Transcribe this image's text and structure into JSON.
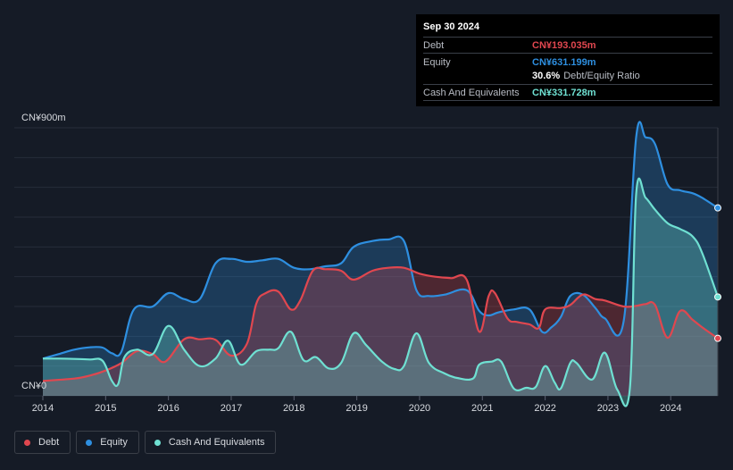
{
  "colors": {
    "debt": "#e0474f",
    "equity": "#2e8fe0",
    "cash": "#6fe0d2",
    "background": "#151b26"
  },
  "tooltip": {
    "date": "Sep 30 2024",
    "debt_label": "Debt",
    "debt_value": "CN¥193.035m",
    "equity_label": "Equity",
    "equity_value": "CN¥631.199m",
    "ratio_value": "30.6%",
    "ratio_label": "Debt/Equity Ratio",
    "cash_label": "Cash And Equivalents",
    "cash_value": "CN¥331.728m"
  },
  "legend": {
    "debt": "Debt",
    "equity": "Equity",
    "cash": "Cash And Equivalents"
  },
  "chart_data": {
    "type": "area",
    "title": "",
    "xlabel": "",
    "ylabel": "",
    "y_top_label": "CN¥900m",
    "y_bottom_label": "CN¥0",
    "ylim": [
      0,
      900
    ],
    "xlim": [
      2014,
      2024.75
    ],
    "x_ticks": [
      "2014",
      "2015",
      "2016",
      "2017",
      "2018",
      "2019",
      "2020",
      "2021",
      "2022",
      "2023",
      "2024"
    ],
    "grid": true,
    "legend_position": "bottom-left",
    "series": [
      {
        "name": "Debt",
        "color_key": "debt",
        "points": [
          [
            2014.0,
            50
          ],
          [
            2014.5,
            58
          ],
          [
            2014.75,
            68
          ],
          [
            2015.0,
            85
          ],
          [
            2015.25,
            110
          ],
          [
            2015.5,
            150
          ],
          [
            2015.75,
            140
          ],
          [
            2015.95,
            115
          ],
          [
            2016.25,
            190
          ],
          [
            2016.5,
            190
          ],
          [
            2016.75,
            188
          ],
          [
            2017.0,
            135
          ],
          [
            2017.25,
            175
          ],
          [
            2017.4,
            310
          ],
          [
            2017.55,
            345
          ],
          [
            2017.75,
            350
          ],
          [
            2017.95,
            290
          ],
          [
            2018.1,
            320
          ],
          [
            2018.3,
            420
          ],
          [
            2018.5,
            425
          ],
          [
            2018.75,
            420
          ],
          [
            2018.95,
            390
          ],
          [
            2019.25,
            420
          ],
          [
            2019.5,
            430
          ],
          [
            2019.75,
            430
          ],
          [
            2020.0,
            410
          ],
          [
            2020.25,
            400
          ],
          [
            2020.5,
            395
          ],
          [
            2020.75,
            390
          ],
          [
            2020.95,
            215
          ],
          [
            2021.1,
            335
          ],
          [
            2021.2,
            345
          ],
          [
            2021.4,
            260
          ],
          [
            2021.55,
            248
          ],
          [
            2021.75,
            240
          ],
          [
            2021.9,
            228
          ],
          [
            2022.0,
            290
          ],
          [
            2022.25,
            295
          ],
          [
            2022.4,
            305
          ],
          [
            2022.6,
            340
          ],
          [
            2022.8,
            325
          ],
          [
            2022.95,
            320
          ],
          [
            2023.25,
            300
          ],
          [
            2023.45,
            302
          ],
          [
            2023.6,
            308
          ],
          [
            2023.75,
            305
          ],
          [
            2023.95,
            195
          ],
          [
            2024.15,
            285
          ],
          [
            2024.35,
            255
          ],
          [
            2024.5,
            230
          ],
          [
            2024.75,
            193
          ]
        ]
      },
      {
        "name": "Equity",
        "color_key": "equity",
        "points": [
          [
            2014.0,
            125
          ],
          [
            2014.25,
            140
          ],
          [
            2014.5,
            155
          ],
          [
            2014.75,
            163
          ],
          [
            2014.95,
            162
          ],
          [
            2015.1,
            143
          ],
          [
            2015.25,
            148
          ],
          [
            2015.45,
            290
          ],
          [
            2015.75,
            300
          ],
          [
            2016.0,
            345
          ],
          [
            2016.25,
            325
          ],
          [
            2016.5,
            325
          ],
          [
            2016.75,
            445
          ],
          [
            2017.0,
            460
          ],
          [
            2017.25,
            450
          ],
          [
            2017.5,
            455
          ],
          [
            2017.75,
            460
          ],
          [
            2018.0,
            430
          ],
          [
            2018.25,
            425
          ],
          [
            2018.5,
            435
          ],
          [
            2018.75,
            445
          ],
          [
            2018.95,
            500
          ],
          [
            2019.25,
            520
          ],
          [
            2019.5,
            525
          ],
          [
            2019.75,
            520
          ],
          [
            2019.95,
            355
          ],
          [
            2020.15,
            335
          ],
          [
            2020.4,
            340
          ],
          [
            2020.75,
            355
          ],
          [
            2020.95,
            285
          ],
          [
            2021.1,
            270
          ],
          [
            2021.25,
            280
          ],
          [
            2021.5,
            290
          ],
          [
            2021.75,
            290
          ],
          [
            2021.95,
            215
          ],
          [
            2022.1,
            230
          ],
          [
            2022.25,
            265
          ],
          [
            2022.4,
            335
          ],
          [
            2022.6,
            340
          ],
          [
            2022.8,
            295
          ],
          [
            2022.95,
            260
          ],
          [
            2023.25,
            250
          ],
          [
            2023.45,
            870
          ],
          [
            2023.6,
            868
          ],
          [
            2023.75,
            845
          ],
          [
            2023.95,
            710
          ],
          [
            2024.15,
            690
          ],
          [
            2024.35,
            680
          ],
          [
            2024.5,
            665
          ],
          [
            2024.75,
            631
          ]
        ]
      },
      {
        "name": "Cash And Equivalents",
        "color_key": "cash",
        "points": [
          [
            2014.0,
            125
          ],
          [
            2014.25,
            125
          ],
          [
            2014.5,
            124
          ],
          [
            2014.75,
            122
          ],
          [
            2014.95,
            118
          ],
          [
            2015.1,
            50
          ],
          [
            2015.2,
            40
          ],
          [
            2015.3,
            130
          ],
          [
            2015.5,
            155
          ],
          [
            2015.75,
            140
          ],
          [
            2016.0,
            235
          ],
          [
            2016.25,
            155
          ],
          [
            2016.5,
            100
          ],
          [
            2016.75,
            125
          ],
          [
            2016.95,
            185
          ],
          [
            2017.15,
            105
          ],
          [
            2017.4,
            150
          ],
          [
            2017.6,
            155
          ],
          [
            2017.75,
            160
          ],
          [
            2017.95,
            215
          ],
          [
            2018.15,
            120
          ],
          [
            2018.35,
            130
          ],
          [
            2018.55,
            92
          ],
          [
            2018.75,
            110
          ],
          [
            2018.95,
            210
          ],
          [
            2019.15,
            170
          ],
          [
            2019.4,
            115
          ],
          [
            2019.6,
            90
          ],
          [
            2019.75,
            100
          ],
          [
            2019.95,
            210
          ],
          [
            2020.15,
            110
          ],
          [
            2020.4,
            75
          ],
          [
            2020.6,
            60
          ],
          [
            2020.85,
            58
          ],
          [
            2020.95,
            105
          ],
          [
            2021.15,
            115
          ],
          [
            2021.3,
            115
          ],
          [
            2021.5,
            25
          ],
          [
            2021.7,
            27
          ],
          [
            2021.85,
            30
          ],
          [
            2022.0,
            100
          ],
          [
            2022.15,
            45
          ],
          [
            2022.25,
            25
          ],
          [
            2022.4,
            110
          ],
          [
            2022.5,
            110
          ],
          [
            2022.75,
            55
          ],
          [
            2022.95,
            145
          ],
          [
            2023.15,
            20
          ],
          [
            2023.35,
            25
          ],
          [
            2023.45,
            680
          ],
          [
            2023.6,
            665
          ],
          [
            2023.75,
            625
          ],
          [
            2023.95,
            580
          ],
          [
            2024.15,
            560
          ],
          [
            2024.35,
            535
          ],
          [
            2024.5,
            480
          ],
          [
            2024.75,
            332
          ]
        ]
      }
    ]
  }
}
